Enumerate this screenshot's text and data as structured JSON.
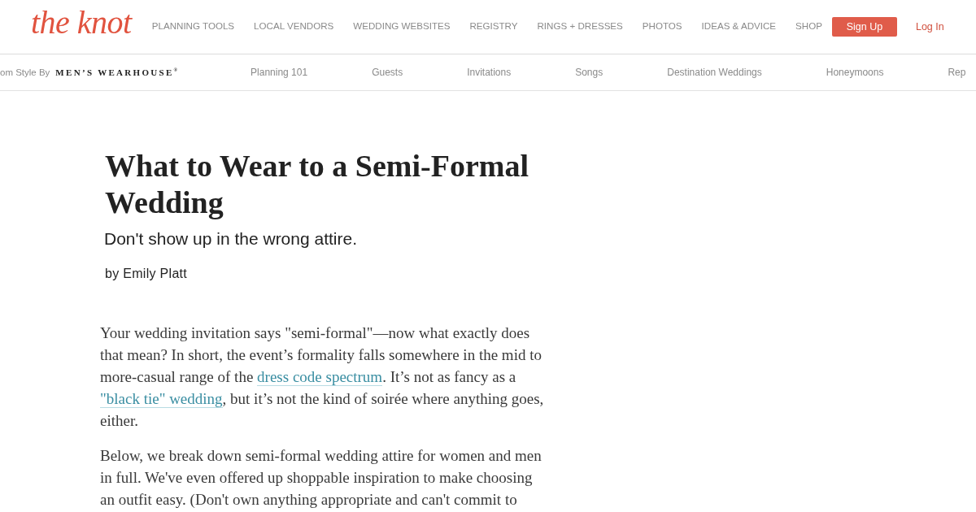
{
  "header": {
    "logo": "the knot",
    "nav": [
      "PLANNING TOOLS",
      "LOCAL VENDORS",
      "WEDDING WEBSITES",
      "REGISTRY",
      "RINGS + DRESSES",
      "PHOTOS",
      "IDEAS & ADVICE",
      "SHOP"
    ],
    "sign_up": "Sign Up",
    "log_in": "Log In"
  },
  "subnav": {
    "sponsor_label": "om Style By",
    "sponsor_logo": "MEN’S WEARHOUSE$^{®}$",
    "links": [
      "Planning 101",
      "Guests",
      "Invitations",
      "Songs",
      "Destination Weddings",
      "Honeymoons",
      "Rep"
    ]
  },
  "article": {
    "title": "What to Wear to a Semi-Formal Wedding",
    "subtitle": "Don't show up in the wrong attire.",
    "byline": "by Emily Platt",
    "paragraphs": [
      [
        {
          "kind": "text",
          "text": "Your wedding invitation says \"semi-formal\"—now what exactly does that mean? In short, the event’s formality falls somewhere in the mid to more-casual range of the "
        },
        {
          "kind": "link",
          "text": "dress code spectrum"
        },
        {
          "kind": "text",
          "text": ". It’s not as fancy as a "
        },
        {
          "kind": "link",
          "text": "\"black tie\" wedding"
        },
        {
          "kind": "text",
          "text": ", but it’s not the kind of soirée where anything goes, either."
        }
      ],
      [
        {
          "kind": "text",
          "text": "Below, we break down semi-formal wedding attire for women and men in full. We've even offered up shoppable inspiration to make choosing an outfit easy. (Don't own anything appropriate and can't commit to"
        }
      ]
    ]
  }
}
